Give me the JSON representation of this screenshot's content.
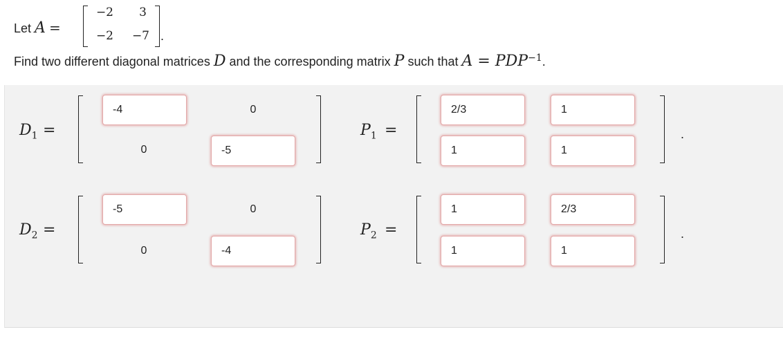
{
  "problem": {
    "let_text": "Let",
    "matrix_name": "A",
    "equals": "=",
    "matrix_a": {
      "r1": [
        "−2",
        "3"
      ],
      "r2": [
        "−2",
        "−7"
      ]
    },
    "period": ".",
    "find_text": "Find two different diagonal matrices",
    "find_d": "D",
    "find_mid": "and the corresponding matrix",
    "find_p": "P",
    "find_such": "such that",
    "find_eq": "A = PDP",
    "find_exp": "−1",
    "find_end": "."
  },
  "answers": {
    "D1": {
      "label": "D",
      "sub": "1",
      "eq": "=",
      "a11": "-4",
      "a12": "0",
      "a21": "0",
      "a22": "-5"
    },
    "P1": {
      "label": "P",
      "sub": "1",
      "eq": "=",
      "a11": "2/3",
      "a12": "1",
      "a21": "1",
      "a22": "1"
    },
    "D2": {
      "label": "D",
      "sub": "2",
      "eq": "=",
      "a11": "-5",
      "a12": "0",
      "a21": "0",
      "a22": "-4"
    },
    "P2": {
      "label": "P",
      "sub": "2",
      "eq": "=",
      "a11": "1",
      "a12": "2/3",
      "a21": "1",
      "a22": "1"
    },
    "row_end": "."
  },
  "colors": {
    "field_border": "#e3a9a9",
    "field_glow": "#d75a5a",
    "answer_bg": "#f2f2f2"
  }
}
